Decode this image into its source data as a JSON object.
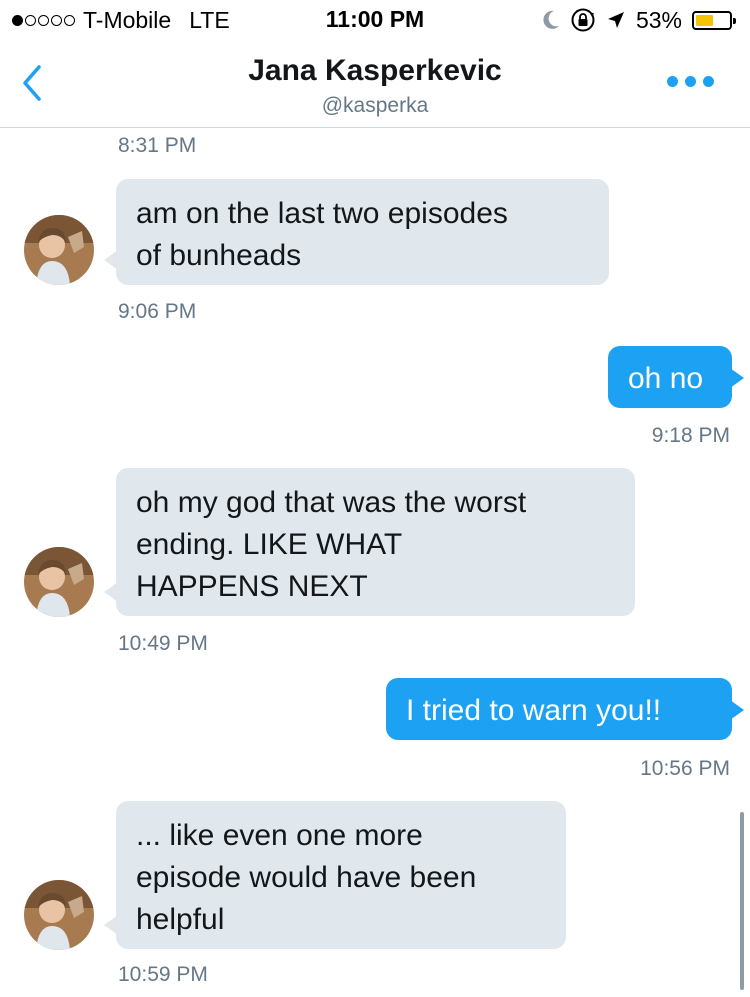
{
  "status_bar": {
    "carrier": "T-Mobile",
    "network": "LTE",
    "time": "11:00 PM",
    "battery_percent": "53%",
    "battery_level": 0.53,
    "icons": [
      "moon-icon",
      "rotation-lock-icon",
      "location-arrow-icon"
    ]
  },
  "header": {
    "name": "Jana Kasperkevic",
    "handle": "@kasperka",
    "accent_color": "#1da1f2"
  },
  "messages": [
    {
      "type": "timestamp",
      "text": "8:31 PM"
    },
    {
      "type": "received",
      "text_lines": [
        "am on the last two episodes",
        "of bunheads"
      ],
      "time": "9:06 PM"
    },
    {
      "type": "sent",
      "text": "oh no",
      "time": "9:18 PM"
    },
    {
      "type": "received",
      "text_lines": [
        "oh my god that was the worst",
        "ending. LIKE WHAT",
        "HAPPENS NEXT"
      ],
      "time": "10:49 PM"
    },
    {
      "type": "sent",
      "text": "I tried to warn you!!",
      "time": "10:56 PM"
    },
    {
      "type": "received",
      "text_lines": [
        "... like even one more",
        "episode would have been",
        "helpful"
      ],
      "time": "10:59 PM"
    }
  ]
}
